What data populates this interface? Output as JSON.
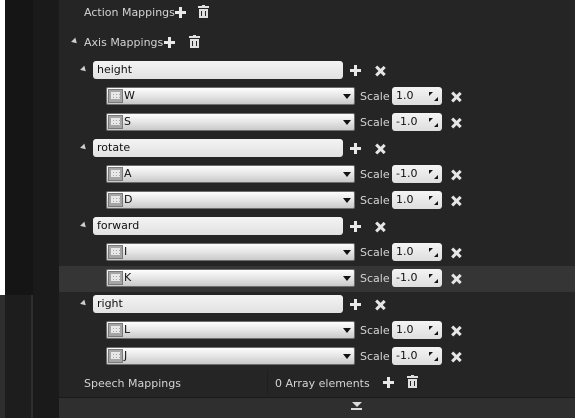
{
  "sections": {
    "action_mappings": "Action Mappings",
    "axis_mappings": "Axis Mappings",
    "speech_mappings": "Speech Mappings",
    "speech_elements": "0 Array elements"
  },
  "scale_label": "Scale",
  "axis_groups": [
    {
      "name": "height",
      "keys": [
        {
          "key": "W",
          "scale": "1.0"
        },
        {
          "key": "S",
          "scale": "-1.0"
        }
      ]
    },
    {
      "name": "rotate",
      "keys": [
        {
          "key": "A",
          "scale": "-1.0"
        },
        {
          "key": "D",
          "scale": "1.0"
        }
      ]
    },
    {
      "name": "forward",
      "keys": [
        {
          "key": "I",
          "scale": "1.0"
        },
        {
          "key": "K",
          "scale": "-1.0"
        }
      ]
    },
    {
      "name": "right",
      "keys": [
        {
          "key": "L",
          "scale": "1.0"
        },
        {
          "key": "J",
          "scale": "-1.0"
        }
      ]
    }
  ],
  "highlighted_key": "K",
  "icons": {
    "add": "plus-icon",
    "remove": "close-icon",
    "delete_all": "trash-icon",
    "expander": "expander-triangle-icon",
    "key": "keyboard-icon",
    "dropdown": "chevron-down-icon",
    "more": "more-chevron-icon"
  }
}
